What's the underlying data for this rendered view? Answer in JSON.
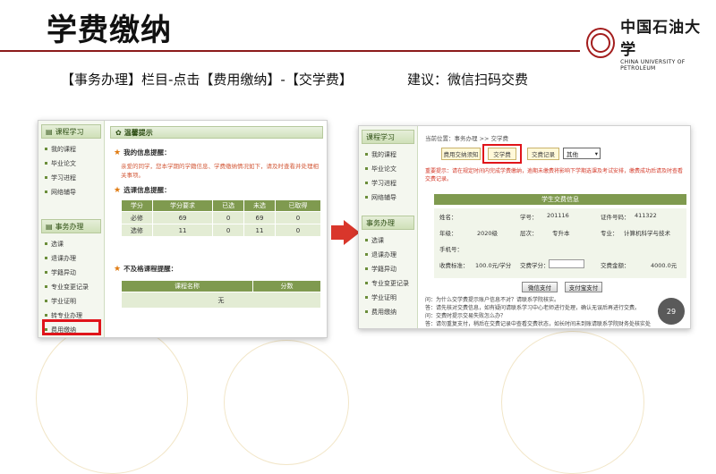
{
  "slide": {
    "title": "学费缴纳",
    "instruction": "【事务办理】栏目-点击【费用缴纳】-【交学费】",
    "suggestion": "建议：微信扫码交费",
    "logo_cn": "中国石油大学",
    "logo_en": "CHINA UNIVERSITY OF PETROLEUM"
  },
  "shot1": {
    "nav_course_head": "课程学习",
    "nav_course_items": [
      "我的课程",
      "毕业论文",
      "学习进程",
      "网络辅导"
    ],
    "nav_affairs_head": "事务办理",
    "nav_affairs_items": [
      "选课",
      "退课办理",
      "学籍异动",
      "专业变更记录",
      "学业证明",
      "转专业办理",
      "费用缴纳"
    ],
    "panel_title": "温馨提示",
    "sec1": "我的信息提醒：",
    "notice": "亲爱的同学，您本学期的学籍信息、学费缴纳情况如下，请及时查看并处理相关事项。",
    "sec2": "选课信息提醒：",
    "table_headers": [
      "学分",
      "学分要求",
      "已选",
      "未选",
      "已取得"
    ],
    "table_rows": [
      [
        "必修",
        "69",
        "0",
        "69",
        "0"
      ],
      [
        "选修",
        "11",
        "0",
        "11",
        "0"
      ]
    ],
    "sec3": "不及格课程提醒：",
    "fail_headers": [
      "课程名称",
      "分数"
    ],
    "fail_empty": "无"
  },
  "shot2": {
    "breadcrumb": "当前位置：事务办理 >> 交学费",
    "tabs": [
      "费用交纳须知",
      "交学费",
      "交费记录"
    ],
    "select_value": "其他",
    "warning": "重要提示：请在规定时间内完成学费缴纳，逾期未缴费将影响下学期选课及考试安排，缴费成功后请及时查看交费记录。",
    "info_title": "学生交费信息",
    "labels": {
      "name": "姓名：",
      "id": "学号：",
      "idcard": "证件号码：",
      "grade": "年级：",
      "level": "层次：",
      "major": "专业：",
      "phone": "手机号：",
      "std": "收费标准：",
      "credits": "交费学分：",
      "total": "交费金额："
    },
    "values": {
      "id": "201116",
      "idcard": "411322",
      "grade": "2020级",
      "level": "专升本",
      "major": "计算机科学与技术",
      "std": "100.0元/学分",
      "total": "4000.0元"
    },
    "btn_wechat": "微信支付",
    "btn_alipay": "支付宝支付",
    "faq": [
      "问：为什么交学费提示账户信息不对？请联系学院核实。",
      "答：请先核对交费信息，如有疑问请联系学习中心老师进行处理，确认无误后再进行交费。",
      "问：交费时提示交易失败怎么办？",
      "答：请勿重复支付，稍后在交费记录中查看交费状态，如长时间未到账请联系学院财务处核实处理。"
    ],
    "speed_value": "29"
  },
  "colors": {
    "title_rule": "#8c1b1b",
    "green_header": "#7f9a4f",
    "highlight": "#e0141a",
    "arrow": "#d9362b"
  }
}
